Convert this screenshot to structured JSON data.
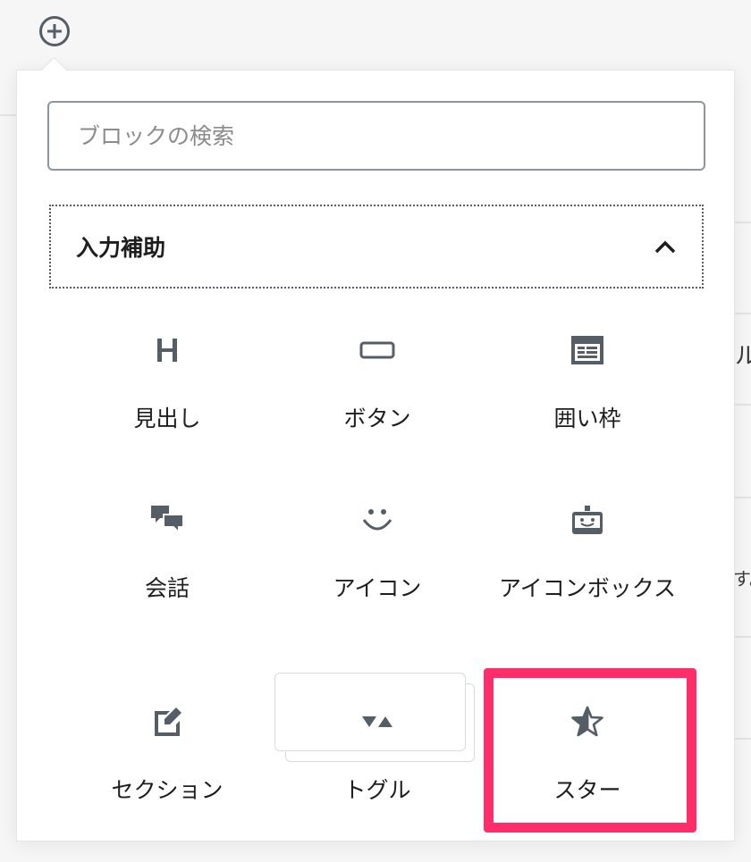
{
  "search": {
    "placeholder": "ブロックの検索"
  },
  "panel": {
    "title": "入力補助"
  },
  "blocks": [
    {
      "label": "見出し",
      "icon": "heading-icon"
    },
    {
      "label": "ボタン",
      "icon": "button-icon"
    },
    {
      "label": "囲い枠",
      "icon": "frame-box-icon"
    },
    {
      "label": "会話",
      "icon": "speech-bubbles-icon"
    },
    {
      "label": "アイコン",
      "icon": "smiley-icon"
    },
    {
      "label": "アイコンボックス",
      "icon": "icon-box-icon"
    },
    {
      "label": "セクション",
      "icon": "edit-section-icon"
    },
    {
      "label": "トグル",
      "icon": "toggle-triangles-icon"
    },
    {
      "label": "スター",
      "icon": "star-icon"
    }
  ],
  "background": {
    "edge_glyph_1": "ル",
    "edge_glyph_2": "す。"
  },
  "colors": {
    "highlight": "#ff2e6b",
    "icon": "#555d66",
    "text": "#1e1e1e"
  }
}
